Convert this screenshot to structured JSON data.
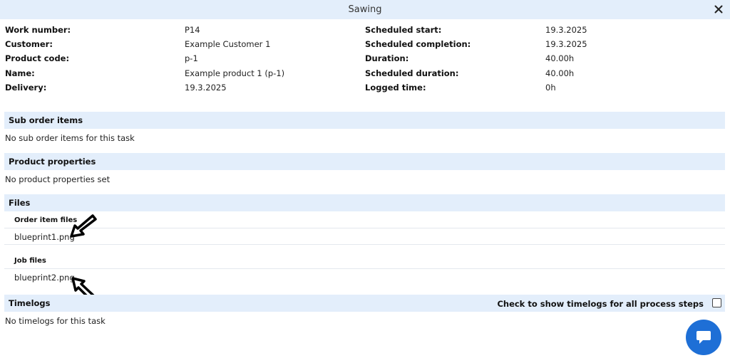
{
  "window": {
    "title": "Sawing"
  },
  "details": {
    "left": [
      {
        "label": "Work number:",
        "value": "P14"
      },
      {
        "label": "Customer:",
        "value": "Example Customer 1"
      },
      {
        "label": "Product code:",
        "value": "p-1"
      },
      {
        "label": "Name:",
        "value": "Example product 1 (p-1)"
      },
      {
        "label": "Delivery:",
        "value": "19.3.2025"
      }
    ],
    "right": [
      {
        "label": "Scheduled start:",
        "value": "19.3.2025"
      },
      {
        "label": "Scheduled completion:",
        "value": "19.3.2025"
      },
      {
        "label": "Duration:",
        "value": "40.00h"
      },
      {
        "label": "Scheduled duration:",
        "value": "40.00h"
      },
      {
        "label": "Logged time:",
        "value": "0h"
      }
    ]
  },
  "sub_order_items": {
    "title": "Sub order items",
    "empty_text": "No sub order items for this task"
  },
  "product_properties": {
    "title": "Product properties",
    "empty_text": "No product properties set"
  },
  "files": {
    "title": "Files",
    "order_item_files": {
      "label": "Order item files",
      "items": [
        "blueprint1.png"
      ]
    },
    "job_files": {
      "label": "Job files",
      "items": [
        "blueprint2.png"
      ]
    }
  },
  "timelogs": {
    "title": "Timelogs",
    "checkbox_label": "Check to show timelogs for all process steps",
    "empty_text": "No timelogs for this task"
  },
  "colors": {
    "section_bg": "#e3eefb",
    "chat_button": "#1e6fd6"
  },
  "icons": {
    "close": "close-icon",
    "chat": "chat-bubble-icon",
    "arrow": "pointer-arrow-icon"
  }
}
